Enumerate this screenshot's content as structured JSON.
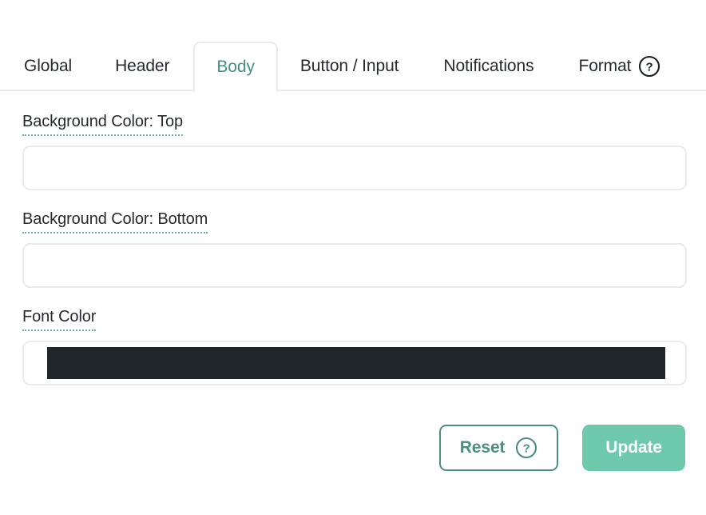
{
  "tabs": [
    {
      "label": "Global",
      "active": false
    },
    {
      "label": "Header",
      "active": false
    },
    {
      "label": "Body",
      "active": true
    },
    {
      "label": "Button / Input",
      "active": false
    },
    {
      "label": "Notifications",
      "active": false
    },
    {
      "label": "Format",
      "active": false
    }
  ],
  "tab_help_icon": "question-circle-icon",
  "fields": [
    {
      "label": "Background Color: Top",
      "value": "",
      "has_swatch": false,
      "swatch_color": ""
    },
    {
      "label": "Background Color: Bottom",
      "value": "",
      "has_swatch": false,
      "swatch_color": ""
    },
    {
      "label": "Font Color",
      "value": "#21262b",
      "has_swatch": true,
      "swatch_color": "#21262b"
    }
  ],
  "actions": {
    "reset_label": "Reset",
    "reset_help_icon": "question-circle-icon",
    "update_label": "Update"
  },
  "colors": {
    "accent_teal": "#4a9077",
    "accent_teal_light": "#6ec9ad",
    "active_tab_text": "#44917a",
    "dotted_underline": "#6db79c",
    "border_gray": "#e9ebee",
    "text_dark": "#26292e",
    "swatch_dark": "#21262b"
  }
}
